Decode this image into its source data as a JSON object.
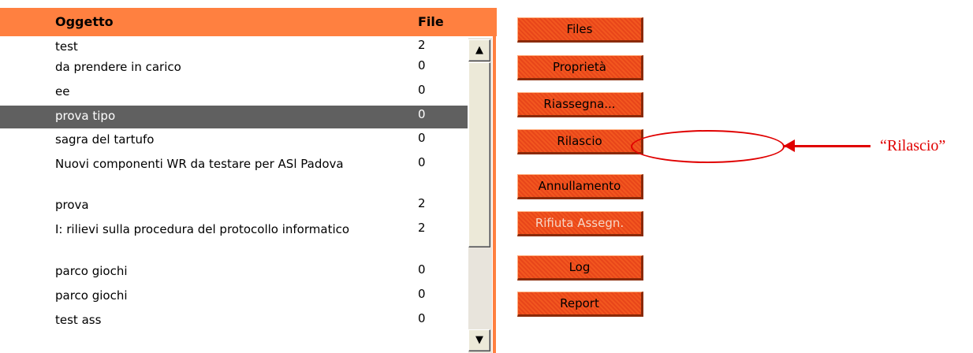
{
  "list": {
    "columns": {
      "subject": "Oggetto",
      "files": "File"
    },
    "rows": [
      {
        "subject": "test",
        "files": "2"
      },
      {
        "subject": "da prendere in carico",
        "files": "0"
      },
      {
        "subject": "ee",
        "files": "0"
      },
      {
        "subject": "prova tipo",
        "files": "0"
      },
      {
        "subject": "sagra del tartufo",
        "files": "0"
      },
      {
        "subject": "Nuovi componenti WR da testare per ASl Padova",
        "files": "0"
      },
      {
        "subject": "prova",
        "files": "2"
      },
      {
        "subject": "I: rilievi sulla procedura del protocollo informatico",
        "files": "2"
      },
      {
        "subject": "parco giochi",
        "files": "0"
      },
      {
        "subject": "parco giochi",
        "files": "0"
      },
      {
        "subject": "test ass",
        "files": "0"
      }
    ],
    "selected_row": 3
  },
  "scrollbar": {
    "up_icon": "▲",
    "down_icon": "▼"
  },
  "buttons": {
    "files": "Files",
    "proprieta": "Proprietà",
    "riassegna": "Riassegna...",
    "rilascio": "Rilascio",
    "annullamento": "Annullamento",
    "rifiuta": "Rifiuta Assegn.",
    "log": "Log",
    "report": "Report"
  },
  "annotation": {
    "label": "“Rilascio”",
    "color": "#e00000"
  },
  "colors": {
    "header": "#ff8040",
    "button": "#f2571f",
    "selected_row": "#606060"
  }
}
